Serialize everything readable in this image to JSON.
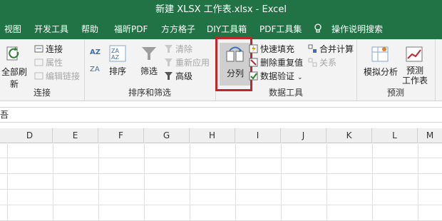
{
  "window": {
    "title": "新建 XLSX 工作表.xlsx  -  Excel"
  },
  "menu": {
    "tabs": [
      {
        "label": "视图"
      },
      {
        "label": "开发工具"
      },
      {
        "label": "帮助"
      },
      {
        "label": "福昕PDF"
      },
      {
        "label": "方方格子"
      },
      {
        "label": "DIY工具箱"
      },
      {
        "label": "PDF工具集"
      },
      {
        "label": "操作说明搜索"
      }
    ]
  },
  "ribbon": {
    "connections": {
      "refresh_label": "全部刷新",
      "connect_label": "连接",
      "properties_label": "属性",
      "edit_links_label": "编辑链接",
      "group_label": "连接"
    },
    "sort_filter": {
      "sort_label": "排序",
      "filter_label": "筛选",
      "clear_label": "清除",
      "reapply_label": "重新应用",
      "advanced_label": "高级",
      "group_label": "排序和筛选"
    },
    "data_tools": {
      "text_to_columns_label": "分列",
      "flash_fill_label": "快速填充",
      "remove_duplicates_label": "删除重复值",
      "data_validation_label": "数据验证",
      "consolidate_label": "合并计算",
      "relationships_label": "关系",
      "group_label": "数据工具"
    },
    "forecast": {
      "what_if_label": "模拟分析",
      "forecast_sheet_label": "预测\n工作表",
      "group_label": "预测"
    }
  },
  "formula_bar": {
    "text": "吾"
  },
  "sheet": {
    "columns": [
      "D",
      "E",
      "F",
      "G",
      "H",
      "I",
      "J",
      "K",
      "L",
      "M"
    ]
  },
  "colors": {
    "accent": "#217346",
    "highlight_border": "#c0262c"
  }
}
